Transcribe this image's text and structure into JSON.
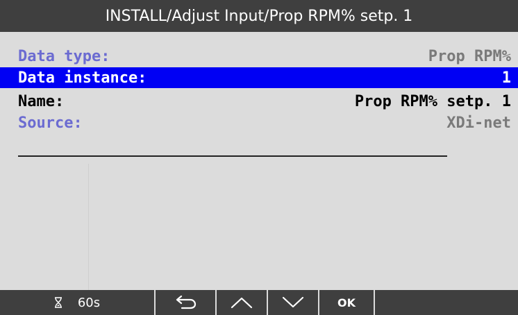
{
  "header": {
    "title": "INSTALL/Adjust Input/Prop RPM% setp. 1"
  },
  "fields": [
    {
      "label": "Data type:",
      "value": "Prop RPM%",
      "state": "dim"
    },
    {
      "label": "Data instance:",
      "value": "1",
      "state": "selected"
    },
    {
      "label": "Name:",
      "value": "Prop RPM% setp. 1",
      "state": "normal"
    },
    {
      "label": "Source:",
      "value": "XDi-net",
      "state": "dim"
    }
  ],
  "footer": {
    "timer_icon": "hourglass-icon",
    "timer_label": "60s",
    "back_icon": "back-arrow-icon",
    "up_icon": "chevron-up-icon",
    "down_icon": "chevron-down-icon",
    "ok_label": "OK"
  },
  "colors": {
    "titlebar": "#3f3f3f",
    "background": "#dcdcdc",
    "selected_row": "#0000f4",
    "dim_label": "#6b6bd1",
    "dim_value": "#7a7a7a"
  }
}
